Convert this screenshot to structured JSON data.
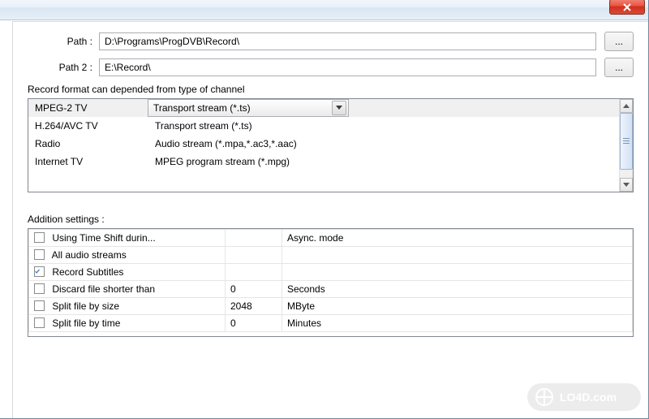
{
  "paths": {
    "path_label": "Path :",
    "path_value": "D:\\Programs\\ProgDVB\\Record\\",
    "path2_label": "Path 2 :",
    "path2_value": "E:\\Record\\",
    "browse_label": "..."
  },
  "format_section_label": "Record format can depended from type of channel",
  "formats": [
    {
      "type": "MPEG-2 TV",
      "value": "Transport stream (*.ts)",
      "selected": true
    },
    {
      "type": "H.264/AVC TV",
      "value": "Transport stream (*.ts)"
    },
    {
      "type": "Radio",
      "value": "Audio stream (*.mpa,*.ac3,*.aac)"
    },
    {
      "type": "Internet TV",
      "value": "MPEG program stream (*.mpg)"
    }
  ],
  "settings_section_label": "Addition settings :",
  "settings": [
    {
      "label": "Using Time Shift durin...",
      "value": "",
      "unit": "Async. mode",
      "checked": false
    },
    {
      "label": "All audio streams",
      "value": "",
      "unit": "",
      "checked": false
    },
    {
      "label": "Record Subtitles",
      "value": "",
      "unit": "",
      "checked": true
    },
    {
      "label": "Discard file shorter than",
      "value": "0",
      "unit": "Seconds",
      "checked": false
    },
    {
      "label": "Split file by size",
      "value": "2048",
      "unit": "MByte",
      "checked": false
    },
    {
      "label": "Split file by time",
      "value": "0",
      "unit": "Minutes",
      "checked": false
    }
  ],
  "watermark": "LO4D.com"
}
